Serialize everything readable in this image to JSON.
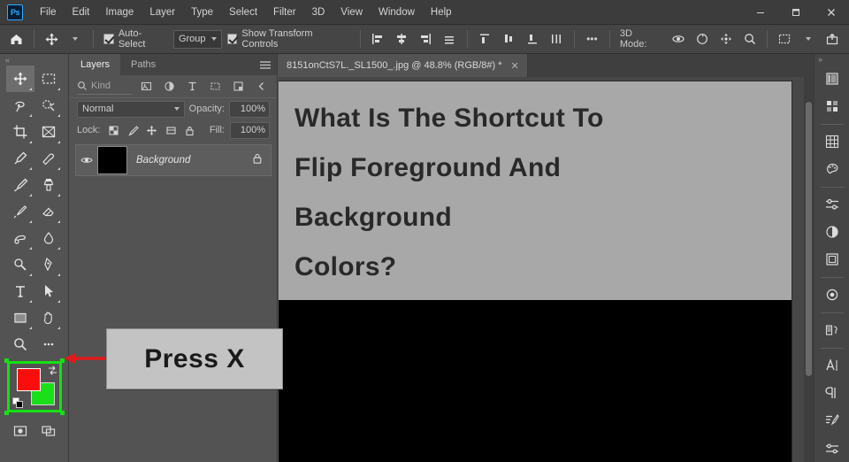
{
  "app": {
    "name": "Ps",
    "logo_text": "Ps"
  },
  "menubar": {
    "items": [
      "File",
      "Edit",
      "Image",
      "Layer",
      "Type",
      "Select",
      "Filter",
      "3D",
      "View",
      "Window",
      "Help"
    ]
  },
  "window_controls": {
    "minimize": "—",
    "restore": "❐",
    "close": "✕"
  },
  "options_bar": {
    "home_icon": "home-icon",
    "tool_icon": "move-tool-icon",
    "auto_select_label": "Auto-Select",
    "auto_select_checked": true,
    "group_value": "Group",
    "show_transform_label": "Show Transform Controls",
    "show_transform_checked": true,
    "align_icons": [
      "align-left-edges",
      "align-horizontal-centers",
      "align-right-edges",
      "align-top-edges"
    ],
    "distribute_icons": [
      "distribute-top-edges",
      "distribute-vertical-centers",
      "distribute-bottom-edges",
      "distribute-spacing"
    ],
    "more_label": "•••",
    "mode_3d_label": "3D Mode:",
    "mode_3d_icons": [
      "orbit-3d-icon",
      "roll-3d-icon",
      "pan-3d-icon",
      "zoom-3d-icon"
    ],
    "arrange_icon": "arrange-documents-icon",
    "share_icon": "share-icon"
  },
  "toolbar": {
    "grip": "«",
    "tools": [
      {
        "name": "move-tool",
        "active": true
      },
      {
        "name": "rectangular-marquee-tool",
        "active": false
      },
      {
        "name": "lasso-tool",
        "active": false
      },
      {
        "name": "object-selection-tool",
        "active": false
      },
      {
        "name": "crop-tool",
        "active": false
      },
      {
        "name": "frame-tool",
        "active": false
      },
      {
        "name": "eyedropper-tool",
        "active": false
      },
      {
        "name": "spot-healing-brush-tool",
        "active": false
      },
      {
        "name": "brush-tool",
        "active": false
      },
      {
        "name": "clone-stamp-tool",
        "active": false
      },
      {
        "name": "history-brush-tool",
        "active": false
      },
      {
        "name": "eraser-tool",
        "active": false
      },
      {
        "name": "gradient-tool",
        "active": false
      },
      {
        "name": "blur-tool",
        "active": false
      },
      {
        "name": "dodge-tool",
        "active": false
      },
      {
        "name": "pen-tool",
        "active": false
      },
      {
        "name": "horizontal-type-tool",
        "active": false
      },
      {
        "name": "path-selection-tool",
        "active": false
      },
      {
        "name": "rectangle-tool",
        "active": false
      },
      {
        "name": "hand-tool",
        "active": false
      },
      {
        "name": "zoom-tool",
        "active": false
      },
      {
        "name": "edit-toolbar-tool",
        "active": false
      }
    ],
    "colors": {
      "foreground_hex": "#fc0d0d",
      "background_hex": "#19e019",
      "highlight_hex": "#14e014",
      "default_colors_icon": "default-foreground-background-icon",
      "swap_colors_icon": "swap-foreground-background-icon"
    },
    "bottom_tools": [
      {
        "name": "quick-mask-mode"
      },
      {
        "name": "screen-mode"
      }
    ]
  },
  "layers_panel": {
    "grip": "«",
    "tabs": [
      {
        "label": "Layers",
        "active": true
      },
      {
        "label": "Paths",
        "active": false
      }
    ],
    "menu_icon": "panel-menu-icon",
    "filter": {
      "search_icon": "search-icon",
      "kind_label": "Kind",
      "icons": [
        "filter-pixel-icon",
        "filter-adjustment-icon",
        "filter-type-icon",
        "filter-shape-icon",
        "filter-smart-object-icon"
      ],
      "toggle_icon": "filter-toggle-icon"
    },
    "blend": {
      "mode_value": "Normal",
      "opacity_label": "Opacity:",
      "opacity_value": "100%"
    },
    "lock": {
      "label": "Lock:",
      "icons": [
        "lock-transparent-pixels-icon",
        "lock-image-pixels-icon",
        "lock-position-icon",
        "lock-artboard-nesting-icon",
        "lock-all-icon"
      ],
      "fill_label": "Fill:",
      "fill_value": "100%"
    },
    "layers": [
      {
        "name": "Background",
        "visible": true,
        "locked": true,
        "thumbnail_hex": "#000000",
        "eye_icon": "eye-icon",
        "lock_icon": "lock-icon"
      }
    ]
  },
  "canvas": {
    "tab": {
      "title": "8151onCtS7L._SL1500_.jpg @ 48.8% (RGB/8#) *",
      "close_icon": "close-icon"
    },
    "document": {
      "background_hex": "#000000",
      "image_band_hex": "#a8a8a8",
      "headline_lines": [
        "What Is The Shortcut To",
        "Flip Foreground And",
        "Background",
        "Colors?"
      ],
      "headline_color": "#292929"
    },
    "scrollbar_icon": "vertical-scrollbar"
  },
  "annotation": {
    "text": "Press X",
    "box_fill_hex": "#c3c3c3",
    "arrow_color_hex": "#e01b1b",
    "arrow_icon": "left-pointing-arrow"
  },
  "right_dock": {
    "grip": "»",
    "icons": [
      {
        "name": "color-panel-icon"
      },
      {
        "name": "libraries-panel-icon"
      },
      {
        "name": "swatches-panel-icon"
      },
      {
        "name": "color-wheel-panel-icon"
      },
      {
        "name": "adjustments-panel-icon"
      },
      {
        "name": "gradients-panel-icon"
      },
      {
        "name": "layers-panel-icon"
      },
      {
        "name": "histogram-panel-icon"
      },
      {
        "name": "properties-panel-icon"
      },
      {
        "name": "character-panel-icon"
      },
      {
        "name": "paragraph-panel-icon"
      },
      {
        "name": "styles-panel-icon"
      },
      {
        "name": "actions-panel-icon"
      }
    ]
  }
}
